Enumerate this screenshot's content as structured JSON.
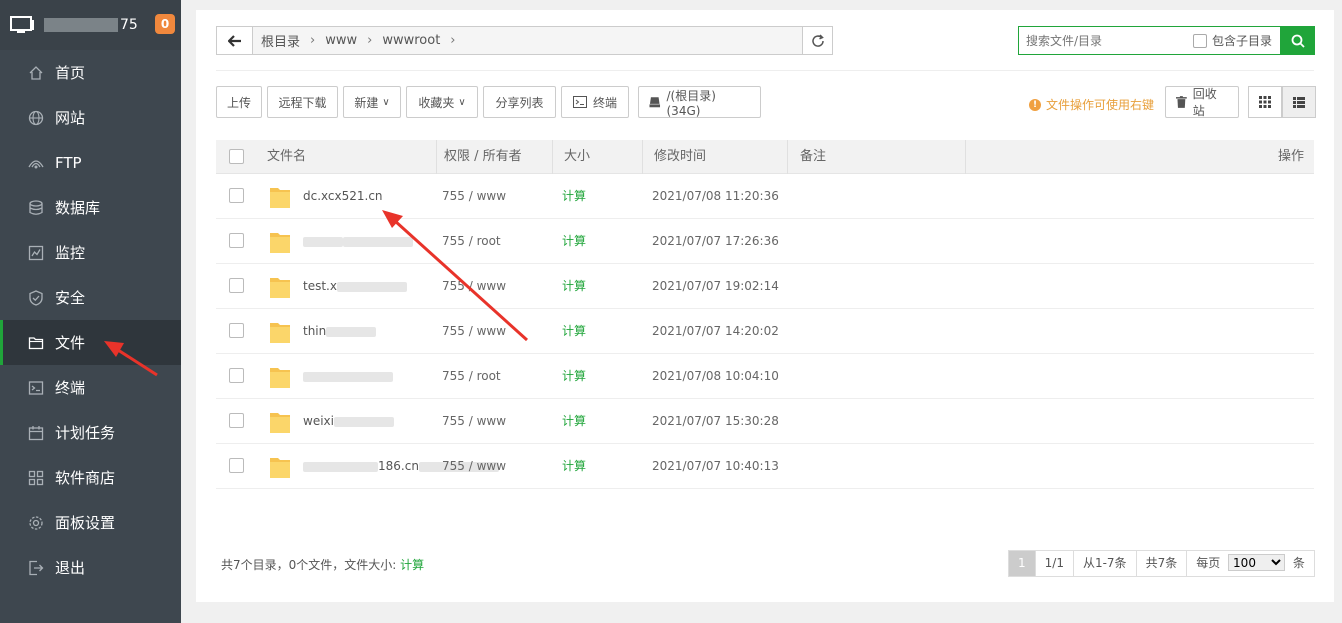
{
  "sidebar": {
    "server_suffix": "75",
    "badge": "0",
    "items": [
      {
        "label": "首页",
        "icon": "home-icon"
      },
      {
        "label": "网站",
        "icon": "globe-icon"
      },
      {
        "label": "FTP",
        "icon": "ftp-icon"
      },
      {
        "label": "数据库",
        "icon": "database-icon"
      },
      {
        "label": "监控",
        "icon": "monitor-chart-icon"
      },
      {
        "label": "安全",
        "icon": "shield-icon"
      },
      {
        "label": "文件",
        "icon": "folder-icon"
      },
      {
        "label": "终端",
        "icon": "terminal-icon"
      },
      {
        "label": "计划任务",
        "icon": "calendar-icon"
      },
      {
        "label": "软件商店",
        "icon": "apps-grid-icon"
      },
      {
        "label": "面板设置",
        "icon": "gear-icon"
      },
      {
        "label": "退出",
        "icon": "logout-icon"
      }
    ],
    "active_index": 6
  },
  "breadcrumb": [
    "根目录",
    "www",
    "wwwroot"
  ],
  "search": {
    "placeholder": "搜索文件/目录",
    "subdir_label": "包含子目录"
  },
  "toolbar": {
    "upload": "上传",
    "remote_download": "远程下载",
    "new": "新建",
    "favorites": "收藏夹",
    "share_list": "分享列表",
    "terminal": "终端",
    "disk": "/(根目录) (34G)",
    "tip": "文件操作可使用右键",
    "recycle": "回收站"
  },
  "table": {
    "headers": {
      "name": "文件名",
      "perm": "权限 / 所有者",
      "size": "大小",
      "mtime": "修改时间",
      "note": "备注",
      "action": "操作"
    },
    "rows": [
      {
        "name": "dc.xcx521.cn",
        "perm": "755 / www",
        "size": "计算",
        "mtime": "2021/07/08 11:20:36"
      },
      {
        "name": "",
        "perm": "755 / root",
        "size": "计算",
        "mtime": "2021/07/07 17:26:36"
      },
      {
        "name": "test.x",
        "perm": "755 / www",
        "size": "计算",
        "mtime": "2021/07/07 19:02:14"
      },
      {
        "name": "thin",
        "perm": "755 / www",
        "size": "计算",
        "mtime": "2021/07/07 14:20:02"
      },
      {
        "name": "",
        "perm": "755 / root",
        "size": "计算",
        "mtime": "2021/07/08 10:04:10"
      },
      {
        "name": "weixi",
        "perm": "755 / www",
        "size": "计算",
        "mtime": "2021/07/07 15:30:28"
      },
      {
        "name": "186.cn",
        "perm": "755 / www",
        "size": "计算",
        "mtime": "2021/07/07 10:40:13"
      }
    ]
  },
  "footer": {
    "summary": "共7个目录，0个文件，文件大小:",
    "calc": "计算"
  },
  "pager": {
    "current": "1",
    "pages": "1/1",
    "range": "从1-7条",
    "total": "共7条",
    "per_page_label": "每页",
    "per_page": "100",
    "unit": "条"
  },
  "colors": {
    "accent": "#20a53a",
    "sidebar": "#3e474f",
    "badge": "#f0883d",
    "arrow": "#e8332a"
  }
}
